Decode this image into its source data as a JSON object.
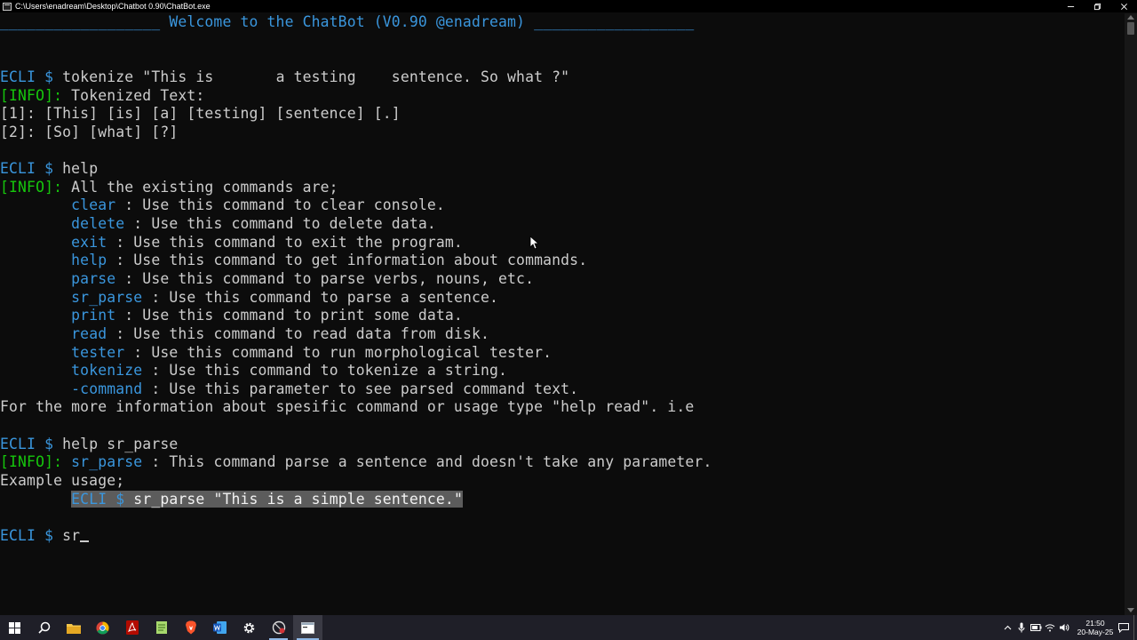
{
  "window": {
    "title": "C:\\Users\\enadream\\Desktop\\Chatbot 0.90\\ChatBot.exe"
  },
  "console": {
    "lines": [
      [
        {
          "t": "__________________ Welcome to the ChatBot (V0.90 @enadream) __________________",
          "c": "blue"
        }
      ],
      [],
      [],
      [
        {
          "t": "ECLI $ ",
          "c": "blue"
        },
        {
          "t": "tokenize \"This is       a testing    sentence. So what ?\""
        }
      ],
      [
        {
          "t": "[INFO]: ",
          "c": "green"
        },
        {
          "t": "Tokenized Text:"
        }
      ],
      [
        {
          "t": "[1]: [This] [is] [a] [testing] [sentence] [.]"
        }
      ],
      [
        {
          "t": "[2]: [So] [what] [?]"
        }
      ],
      [],
      [
        {
          "t": "ECLI $ ",
          "c": "blue"
        },
        {
          "t": "help"
        }
      ],
      [
        {
          "t": "[INFO]: ",
          "c": "green"
        },
        {
          "t": "All the existing commands are;"
        }
      ],
      [
        {
          "t": "        "
        },
        {
          "t": "clear",
          "c": "blue"
        },
        {
          "t": " : Use this command to clear console."
        }
      ],
      [
        {
          "t": "        "
        },
        {
          "t": "delete",
          "c": "blue"
        },
        {
          "t": " : Use this command to delete data."
        }
      ],
      [
        {
          "t": "        "
        },
        {
          "t": "exit",
          "c": "blue"
        },
        {
          "t": " : Use this command to exit the program."
        }
      ],
      [
        {
          "t": "        "
        },
        {
          "t": "help",
          "c": "blue"
        },
        {
          "t": " : Use this command to get information about commands."
        }
      ],
      [
        {
          "t": "        "
        },
        {
          "t": "parse",
          "c": "blue"
        },
        {
          "t": " : Use this command to parse verbs, nouns, etc."
        }
      ],
      [
        {
          "t": "        "
        },
        {
          "t": "sr_parse",
          "c": "blue"
        },
        {
          "t": " : Use this command to parse a sentence."
        }
      ],
      [
        {
          "t": "        "
        },
        {
          "t": "print",
          "c": "blue"
        },
        {
          "t": " : Use this command to print some data."
        }
      ],
      [
        {
          "t": "        "
        },
        {
          "t": "read",
          "c": "blue"
        },
        {
          "t": " : Use this command to read data from disk."
        }
      ],
      [
        {
          "t": "        "
        },
        {
          "t": "tester",
          "c": "blue"
        },
        {
          "t": " : Use this command to run morphological tester."
        }
      ],
      [
        {
          "t": "        "
        },
        {
          "t": "tokenize",
          "c": "blue"
        },
        {
          "t": " : Use this command to tokenize a string."
        }
      ],
      [
        {
          "t": "        "
        },
        {
          "t": "-command",
          "c": "blue"
        },
        {
          "t": " : Use this parameter to see parsed command text."
        }
      ],
      [
        {
          "t": "For the more information about spesific command or usage type \"help read\". i.e"
        }
      ],
      [],
      [
        {
          "t": "ECLI $ ",
          "c": "blue"
        },
        {
          "t": "help sr_parse"
        }
      ],
      [
        {
          "t": "[INFO]: ",
          "c": "green"
        },
        {
          "t": "sr_parse",
          "c": "blue"
        },
        {
          "t": " : This command parse a sentence and doesn't take any parameter."
        }
      ],
      [
        {
          "t": "Example usage;"
        }
      ],
      [
        {
          "t": "        "
        },
        {
          "t": "ECLI $ ",
          "c": "blue",
          "sel": true
        },
        {
          "t": "sr_parse \"This is a simple sentence.\"",
          "c": "white",
          "sel": true
        }
      ],
      [],
      [
        {
          "t": "ECLI $ ",
          "c": "blue"
        },
        {
          "t": "sr"
        }
      ]
    ]
  },
  "taskbar": {
    "apps": [
      {
        "name": "start-button",
        "icon": "windows-logo-icon"
      },
      {
        "name": "search-button",
        "icon": "search-icon"
      },
      {
        "name": "taskbar-file-explorer",
        "icon": "folder-icon"
      },
      {
        "name": "taskbar-chrome",
        "icon": "chrome-icon"
      },
      {
        "name": "taskbar-acrobat",
        "icon": "acrobat-icon"
      },
      {
        "name": "taskbar-notepad-plus",
        "icon": "notepad-icon"
      },
      {
        "name": "taskbar-brave",
        "icon": "brave-icon"
      },
      {
        "name": "taskbar-word",
        "icon": "word-icon"
      },
      {
        "name": "taskbar-settings",
        "icon": "gear-icon"
      },
      {
        "name": "taskbar-app-red",
        "icon": "app-icon"
      },
      {
        "name": "taskbar-console",
        "icon": "console-icon"
      }
    ],
    "clock": {
      "time": "21:50",
      "date": "20-May-25"
    }
  },
  "colors": {
    "console_bg": "#0c0c0c",
    "console_fg": "#cccccc",
    "blue": "#3a96dd",
    "green": "#16c60c",
    "selection": "#5c5c5c",
    "taskbar_bg": "#1f1f28"
  }
}
